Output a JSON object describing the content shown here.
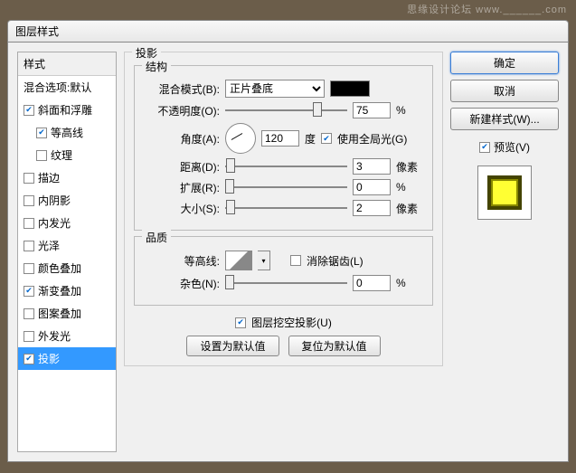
{
  "watermark": "思缘设计论坛  www.______.com",
  "dialog_title": "图层样式",
  "sidebar": {
    "header": "样式",
    "items": [
      {
        "label": "混合选项:默认",
        "checked": null
      },
      {
        "label": "斜面和浮雕",
        "checked": true
      },
      {
        "label": "等高线",
        "checked": true,
        "indent": true
      },
      {
        "label": "纹理",
        "checked": false,
        "indent": true
      },
      {
        "label": "描边",
        "checked": false
      },
      {
        "label": "内阴影",
        "checked": false
      },
      {
        "label": "内发光",
        "checked": false
      },
      {
        "label": "光泽",
        "checked": false
      },
      {
        "label": "颜色叠加",
        "checked": false
      },
      {
        "label": "渐变叠加",
        "checked": true
      },
      {
        "label": "图案叠加",
        "checked": false
      },
      {
        "label": "外发光",
        "checked": false
      },
      {
        "label": "投影",
        "checked": true,
        "selected": true
      }
    ]
  },
  "panel": {
    "title": "投影",
    "structure": {
      "title": "结构",
      "blend_mode_label": "混合模式(B):",
      "blend_mode_value": "正片叠底",
      "opacity_label": "不透明度(O):",
      "opacity_value": "75",
      "opacity_unit": "%",
      "angle_label": "角度(A):",
      "angle_value": "120",
      "angle_unit": "度",
      "global_light_label": "使用全局光(G)",
      "global_light_checked": true,
      "distance_label": "距离(D):",
      "distance_value": "3",
      "distance_unit": "像素",
      "spread_label": "扩展(R):",
      "spread_value": "0",
      "spread_unit": "%",
      "size_label": "大小(S):",
      "size_value": "2",
      "size_unit": "像素"
    },
    "quality": {
      "title": "品质",
      "contour_label": "等高线:",
      "antialias_label": "消除锯齿(L)",
      "antialias_checked": false,
      "noise_label": "杂色(N):",
      "noise_value": "0",
      "noise_unit": "%"
    },
    "knockout_label": "图层挖空投影(U)",
    "knockout_checked": true,
    "btn_default": "设置为默认值",
    "btn_reset": "复位为默认值"
  },
  "actions": {
    "ok": "确定",
    "cancel": "取消",
    "new_style": "新建样式(W)...",
    "preview_label": "预览(V)",
    "preview_checked": true
  }
}
